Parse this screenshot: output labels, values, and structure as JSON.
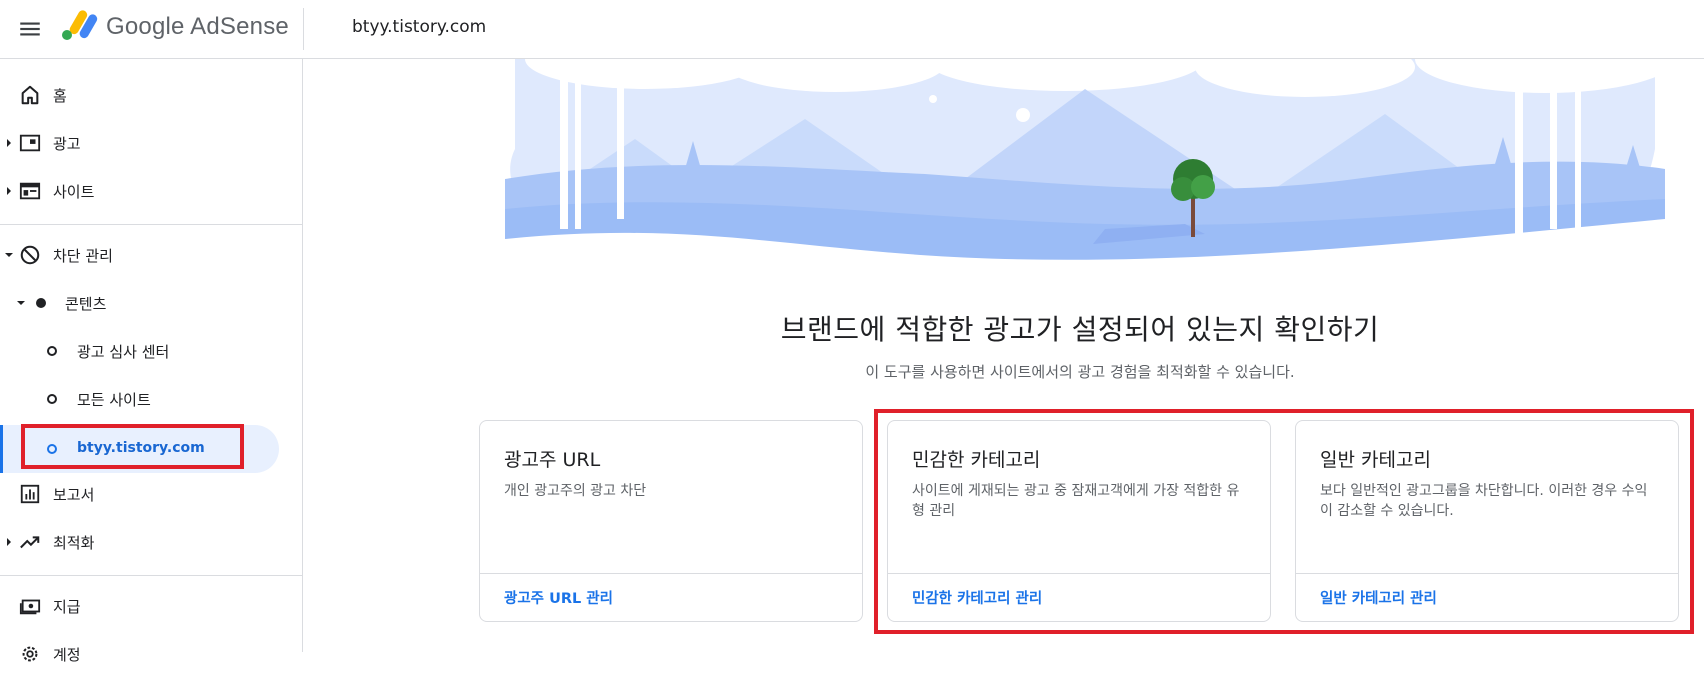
{
  "header": {
    "app_name": "Google AdSense",
    "site_name": "btyy.tistory.com"
  },
  "sidebar": {
    "items": [
      {
        "label": "홈",
        "icon": "home-icon"
      },
      {
        "label": "광고",
        "icon": "ads-icon"
      },
      {
        "label": "사이트",
        "icon": "sites-icon"
      },
      {
        "label": "차단 관리",
        "icon": "block-icon"
      },
      {
        "label": "콘텐츠",
        "icon": "dot-icon"
      },
      {
        "label": "광고 심사 센터",
        "icon": "circle-icon"
      },
      {
        "label": "모든 사이트",
        "icon": "circle-icon"
      },
      {
        "label": "btyy.tistory.com",
        "icon": "circle-icon"
      },
      {
        "label": "보고서",
        "icon": "reports-icon"
      },
      {
        "label": "최적화",
        "icon": "trending-icon"
      },
      {
        "label": "지급",
        "icon": "payments-icon"
      },
      {
        "label": "계정",
        "icon": "settings-icon"
      }
    ]
  },
  "main": {
    "title": "브랜드에 적합한 광고가 설정되어 있는지 확인하기",
    "subtitle": "이 도구를 사용하면 사이트에서의 광고 경험을 최적화할 수 있습니다.",
    "cards": [
      {
        "title": "광고주 URL",
        "description": "개인 광고주의 광고 차단",
        "link": "광고주 URL 관리"
      },
      {
        "title": "민감한 카테고리",
        "description": "사이트에 게재되는 광고 중 잠재고객에게 가장 적합한 유형 관리",
        "link": "민감한 카테고리 관리"
      },
      {
        "title": "일반 카테고리",
        "description": "보다 일반적인 광고그룹을 차단합니다. 이러한 경우 수익이 감소할 수 있습니다.",
        "link": "일반 카테고리 관리"
      }
    ]
  },
  "colors": {
    "accent": "#1a73e8",
    "highlight": "#e0202a",
    "active_bg": "#e8f0fe"
  }
}
